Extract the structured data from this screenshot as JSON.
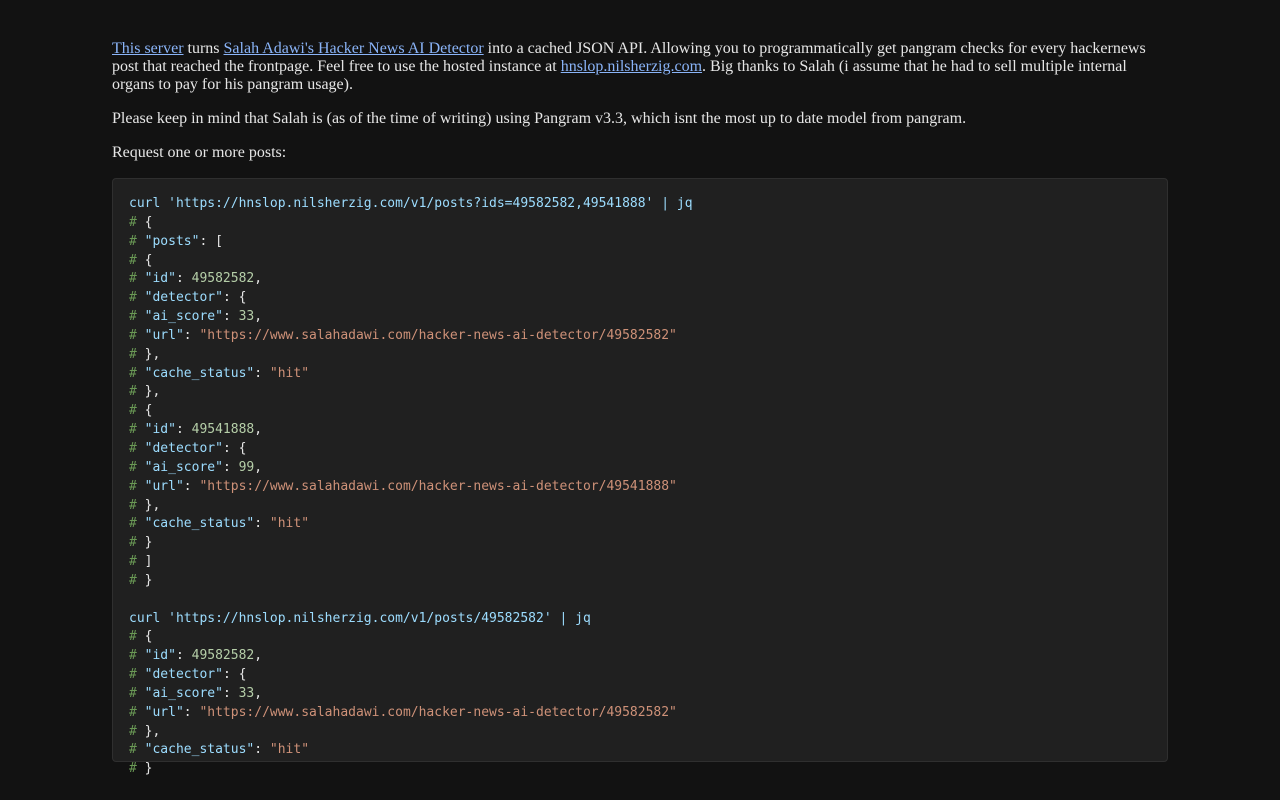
{
  "intro": {
    "link1": "This server",
    "text1": " turns ",
    "link2": "Salah Adawi's Hacker News AI Detector",
    "text2": " into a cached JSON API. Allowing you to programmatically get pangram checks for every hackernews post that reached the frontpage. Feel free to use the hosted instance at ",
    "link3": "hnslop.nilsherzig.com",
    "text3": ". Big thanks to Salah (i assume that he had to sell multiple internal organs to pay for his pangram usage)."
  },
  "note": "Please keep in mind that Salah is (as of the time of writing) using Pangram v3.3, which isnt the most up to date model from pangram.",
  "request_label": "Request one or more posts:",
  "code": {
    "comment_marker": "#",
    "cmd1": "curl 'https://hnslop.nilsherzig.com/v1/posts?ids=49582582,49541888' | jq",
    "cmd2": "curl 'https://hnslop.nilsherzig.com/v1/posts/49582582' | jq",
    "keys": {
      "posts": "\"posts\"",
      "id": "\"id\"",
      "detector": "\"detector\"",
      "ai_score": "\"ai_score\"",
      "url": "\"url\"",
      "cache_status": "\"cache_status\""
    },
    "post1": {
      "id": "49582582",
      "ai_score": "33",
      "url": "\"https://www.salahadawi.com/hacker-news-ai-detector/49582582\"",
      "cache_status": "\"hit\""
    },
    "post2": {
      "id": "49541888",
      "ai_score": "99",
      "url": "\"https://www.salahadawi.com/hacker-news-ai-detector/49541888\"",
      "cache_status": "\"hit\""
    },
    "post3": {
      "id": "49582582",
      "ai_score": "33",
      "url": "\"https://www.salahadawi.com/hacker-news-ai-detector/49582582\"",
      "cache_status": "\"hit\""
    }
  }
}
